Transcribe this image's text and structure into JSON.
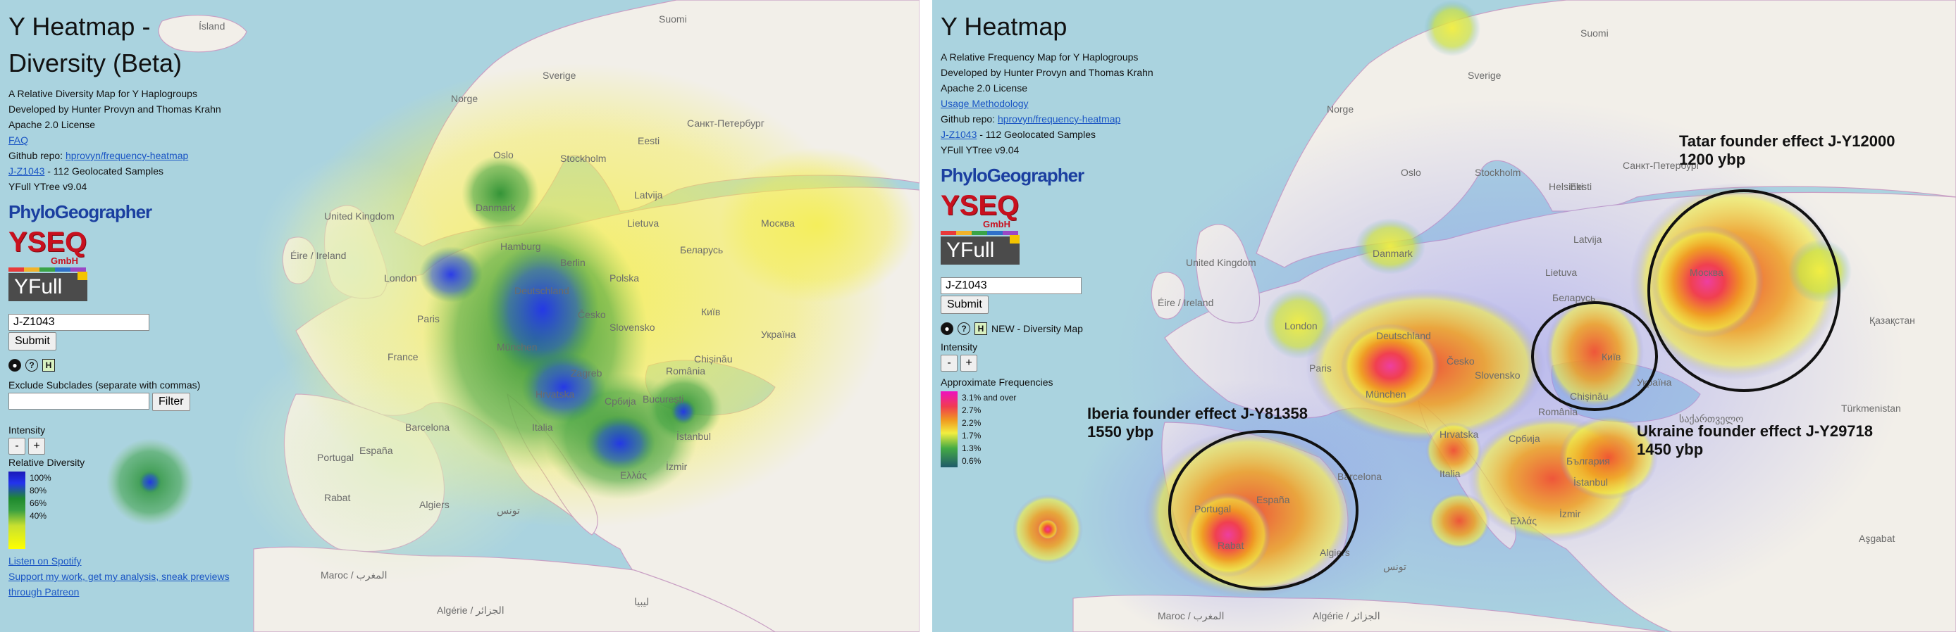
{
  "left": {
    "title": "Y Heatmap - Diversity (Beta)",
    "subtitle": "A Relative Diversity Map for Y Haplogroups",
    "developers": "Developed by Hunter Provyn and Thomas Krahn",
    "license": "Apache 2.0 License",
    "faq_link": "FAQ",
    "github_label": "Github repo: ",
    "github_link": "hprovyn/frequency-heatmap",
    "clade_link": "J-Z1043",
    "samples_text": " - 112 Geolocated Samples",
    "tree_version": "YFull YTree v9.04",
    "logos": {
      "phylogeographer": "PhyloGeographer",
      "yseq": "YSEQ",
      "gmbh": "GmbH",
      "yfull": "YFull"
    },
    "search_value": "J-Z1043",
    "submit_label": "Submit",
    "exclude_label": "Exclude Subclades (separate with commas)",
    "exclude_value": "",
    "filter_label": "Filter",
    "intensity_label": "Intensity",
    "minus_label": "-",
    "plus_label": "+",
    "legend_title": "Relative Diversity",
    "legend_ticks": [
      "100%",
      "80%",
      "66%",
      "40%"
    ],
    "footer_spotify": "Listen on Spotify",
    "footer_patreon_1": "Support my work, get my analysis, sneak previews",
    "footer_patreon_2": "through Patreon"
  },
  "right": {
    "title": "Y Heatmap",
    "subtitle": "A Relative Frequency Map for Y Haplogroups",
    "developers": "Developed by Hunter Provyn and Thomas Krahn",
    "license": "Apache 2.0 License",
    "methodology_link": "Usage Methodology",
    "github_label": "Github repo: ",
    "github_link": "hprovyn/frequency-heatmap",
    "clade_link": "J-Z1043",
    "samples_text": " - 112 Geolocated Samples",
    "tree_version": "YFull YTree v9.04",
    "logos": {
      "phylogeographer": "PhyloGeographer",
      "yseq": "YSEQ",
      "gmbh": "GmbH",
      "yfull": "YFull"
    },
    "search_value": "J-Z1043",
    "submit_label": "Submit",
    "new_label": "NEW - Diversity Map",
    "intensity_label": "Intensity",
    "minus_label": "-",
    "plus_label": "+",
    "legend_title": "Approximate Frequencies",
    "legend_ticks": [
      "3.1% and over",
      "2.7%",
      "2.2%",
      "1.7%",
      "1.3%",
      "0.6%"
    ],
    "annotations": {
      "tatar_1": "Tatar founder effect J-Y12000",
      "tatar_2": "1200 ybp",
      "iberia_1": "Iberia founder effect J-Y81358",
      "iberia_2": "1550 ybp",
      "ukraine_1": "Ukraine founder effect J-Y29718",
      "ukraine_2": "1450 ybp"
    }
  },
  "map_labels_left": {
    "island": "Ísland",
    "suomi": "Suomi",
    "sverige": "Sverige",
    "norge": "Norge",
    "spb": "Санкт-Петербург",
    "eesti": "Eesti",
    "stockholm": "Stockholm",
    "oslo": "Oslo",
    "latvija": "Latvija",
    "danmark": "Danmark",
    "lietuva": "Lietuva",
    "moskva": "Москва",
    "uk": "United Kingdom",
    "eire": "Éire / Ireland",
    "hamburg": "Hamburg",
    "berlin": "Berlin",
    "belarus": "Беларусь",
    "polska": "Polska",
    "london": "London",
    "deutschland": "Deutschland",
    "paris": "Paris",
    "cesko": "Česko",
    "kyiv": "Київ",
    "ukraina": "Україна",
    "france": "France",
    "munchen": "München",
    "slovensko": "Slovensko",
    "zagreb": "Zagreb",
    "chisinau": "Chișinău",
    "romania": "România",
    "hrvatska": "Hrvatska",
    "srbija": "Србија",
    "bucuresti": "București",
    "barcelona": "Barcelona",
    "italia": "Italia",
    "istanbul": "İstanbul",
    "portugal": "Portugal",
    "espana": "España",
    "ellas": "Ελλάς",
    "izmir": "İzmir",
    "rabat": "Rabat",
    "algiers": "Algiers",
    "tunis": "تونس",
    "maroc": "Maroc / المغرب",
    "algerie": "Algérie / الجزائر",
    "libya": "ليبيا"
  },
  "map_labels_right": {
    "sverige": "Sverige",
    "suomi": "Suomi",
    "norge": "Norge",
    "spb": "Санкт-Петербург",
    "eesti": "Eesti",
    "helsinki": "Helsinki",
    "oslo": "Oslo",
    "stockholm": "Stockholm",
    "latvija": "Latvija",
    "danmark": "Danmark",
    "lietuva": "Lietuva",
    "moskva": "Москва",
    "uk": "United Kingdom",
    "eire": "Éire / Ireland",
    "belarus": "Беларусь",
    "london": "London",
    "deutschland": "Deutschland",
    "paris": "Paris",
    "cesko": "Česko",
    "kyiv": "Київ",
    "ukraina": "Україна",
    "chisinau": "Chișinău",
    "munchen": "München",
    "slovensko": "Slovensko",
    "hrvatska": "Hrvatska",
    "srbija": "Србија",
    "romania": "România",
    "bulgaria": "България",
    "barcelona": "Barcelona",
    "italia": "Italia",
    "istanbul": "İstanbul",
    "portugal": "Portugal",
    "espana": "España",
    "rabat": "Rabat",
    "algiers": "Algiers",
    "izmir": "İzmir",
    "ellas": "Ελλάς",
    "turkmenistan": "Türkmenistan",
    "qazaqstan": "Қазақстан",
    "ashgabat": "Aşgabat",
    "georgia": "საქართველო",
    "tunis": "تونس",
    "maroc": "Maroc / المغرب",
    "algerie": "Algérie / الجزائر"
  },
  "colors": {
    "sea": "#aad3df",
    "land": "#f2efe9",
    "border": "#c9a0c4",
    "diversity_high": "#2233dd",
    "diversity_mid": "#1f8a2e",
    "diversity_low": "#f3ef5a",
    "freq_high": "#ee3fa0",
    "freq_mid": "#f0a020",
    "freq_low": "#f2ee40",
    "freq_halo": "#8a8cf0"
  },
  "icons": [
    "dark-circle-icon",
    "help-icon",
    "map-mode-icon"
  ]
}
